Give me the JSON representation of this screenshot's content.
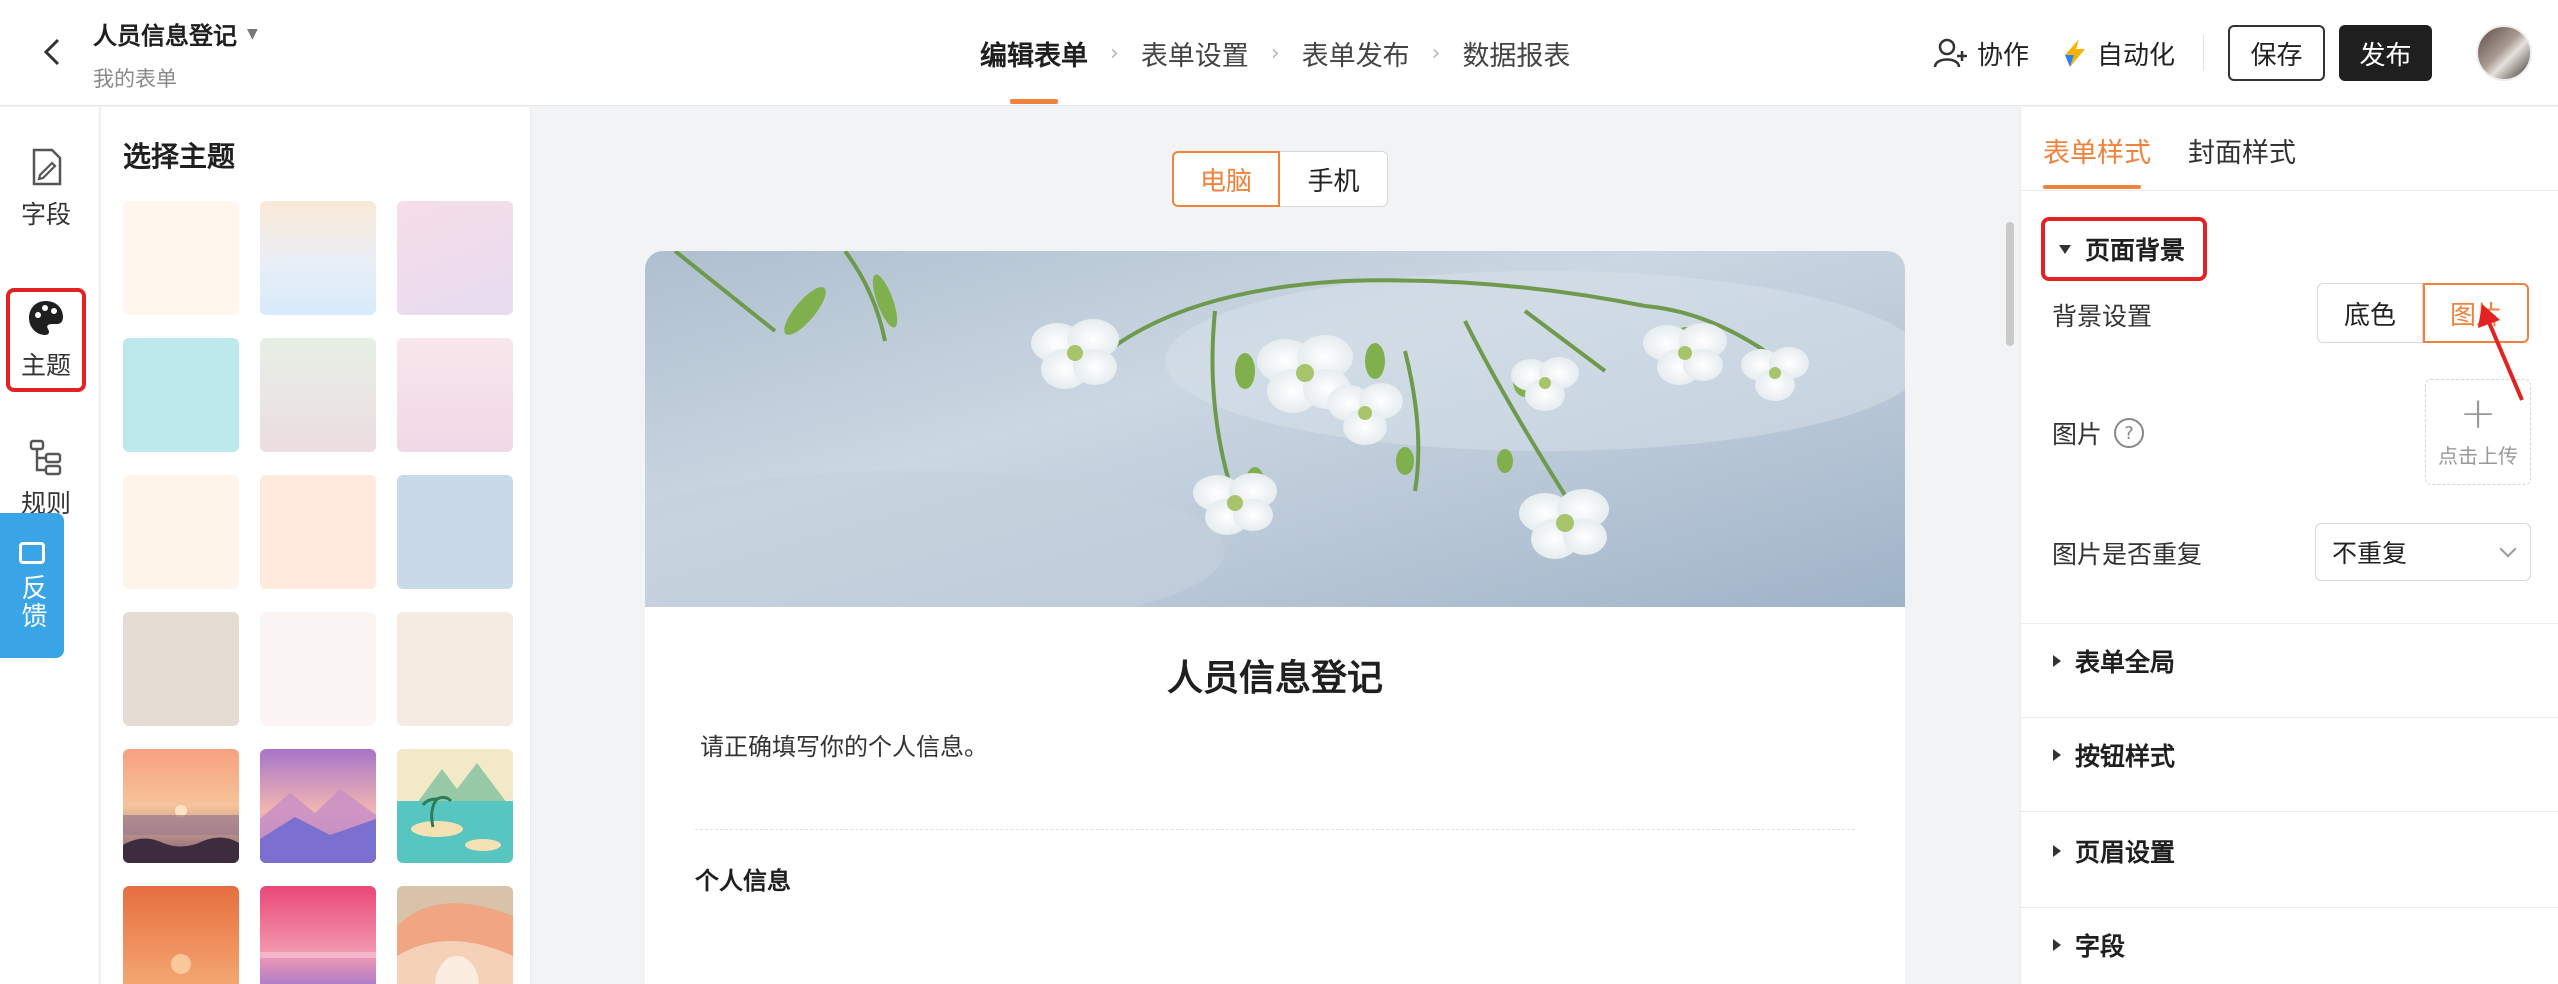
{
  "header": {
    "title": "人员信息登记",
    "subtitle": "我的表单",
    "steps": [
      {
        "label": "编辑表单",
        "active": true
      },
      {
        "label": "表单设置",
        "active": false
      },
      {
        "label": "表单发布",
        "active": false
      },
      {
        "label": "数据报表",
        "active": false
      }
    ],
    "collab_label": "协作",
    "automation_label": "自动化",
    "save_label": "保存",
    "publish_label": "发布"
  },
  "leftnav": {
    "items": [
      {
        "label": "字段",
        "icon": "field-edit-icon"
      },
      {
        "label": "主题",
        "icon": "palette-icon",
        "active": true
      },
      {
        "label": "规则",
        "icon": "rules-tree-icon"
      }
    ],
    "feedback_label": "反馈"
  },
  "theme_panel": {
    "title": "选择主题",
    "swatch_icon_names": [
      "cream-theme",
      "pastel-rainbow-theme",
      "lavender-pink-theme",
      "aqua-theme",
      "mint-rose-theme",
      "soft-pink-theme",
      "peach-theme",
      "apricot-theme",
      "powder-blue-theme",
      "taupe-theme",
      "off-white-theme",
      "linen-theme",
      "sunset-sea-theme",
      "purple-mountains-theme",
      "tropical-island-theme",
      "orange-dusk-theme",
      "pink-sky-theme",
      "abstract-waves-theme"
    ]
  },
  "canvas": {
    "device_pc": "电脑",
    "device_mobile": "手机",
    "form_title": "人员信息登记",
    "form_description": "请正确填写你的个人信息。",
    "section_title": "个人信息"
  },
  "right_panel": {
    "tabs": [
      {
        "label": "表单样式",
        "active": true
      },
      {
        "label": "封面样式",
        "active": false
      }
    ],
    "page_background": {
      "title": "页面背景",
      "bg_setting_label": "背景设置",
      "bg_option_color": "底色",
      "bg_option_image": "图片",
      "bg_option_selected": "图片",
      "image_label": "图片",
      "upload_label": "点击上传",
      "repeat_label": "图片是否重复",
      "repeat_value": "不重复"
    },
    "collapsed_sections": [
      "表单全局",
      "按钮样式",
      "页眉设置",
      "字段"
    ]
  },
  "colors": {
    "accent": "#f0823c",
    "annotation_red": "#e32323",
    "feedback_blue": "#3aa5e6"
  }
}
